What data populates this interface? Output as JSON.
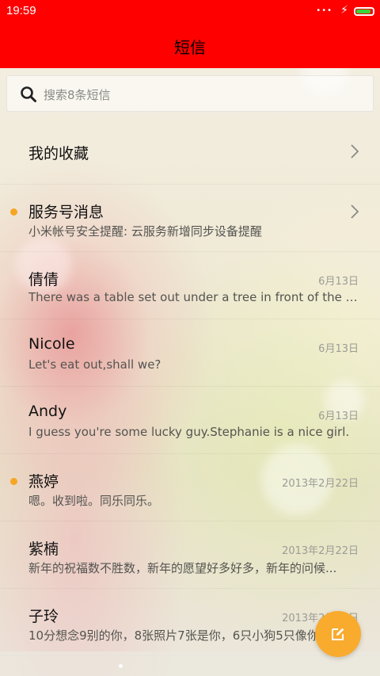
{
  "status_bar": {
    "time": "19:59",
    "dots": "•••",
    "charging_glyph": "⚡",
    "battery_level": 0.92,
    "background": "#ff0000"
  },
  "header": {
    "title": "短信",
    "background": "#ff0000"
  },
  "search": {
    "placeholder": "搜索8条短信",
    "icon": "search-icon"
  },
  "conversations": [
    {
      "name": "我的收藏",
      "preview": "",
      "date": "",
      "unread": false,
      "chevron": true
    },
    {
      "name": "服务号消息",
      "preview": "小米帐号安全提醒: 云服务新增同步设备提醒",
      "date": "",
      "unread": true,
      "chevron": true
    },
    {
      "name": "倩倩",
      "preview": "There was a table set out under a tree in front of the ho...",
      "date": "6月13日",
      "unread": false,
      "chevron": false
    },
    {
      "name": "Nicole",
      "preview": "Let's eat out,shall we?",
      "date": "6月13日",
      "unread": false,
      "chevron": false
    },
    {
      "name": "Andy",
      "preview": "I guess you're some lucky guy.Stephanie is a nice girl.",
      "date": "6月13日",
      "unread": false,
      "chevron": false
    },
    {
      "name": "燕婷",
      "preview": "嗯。收到啦。同乐同乐。",
      "date": "2013年2月22日",
      "unread": true,
      "chevron": false
    },
    {
      "name": "紫楠",
      "preview": "新年的祝福数不胜数，新年的愿望好多好多，新年的问候...",
      "date": "2013年2月22日",
      "unread": false,
      "chevron": false
    },
    {
      "name": "子玲",
      "preview": "10分想念9别的你，8张照片7张是你，6只小狗5只像你",
      "date": "2013年2月22日",
      "unread": false,
      "chevron": false
    }
  ],
  "compose_button": {
    "icon": "compose-icon",
    "color": "#f9ab2e"
  },
  "colors": {
    "unread_dot": "#f5a623"
  }
}
